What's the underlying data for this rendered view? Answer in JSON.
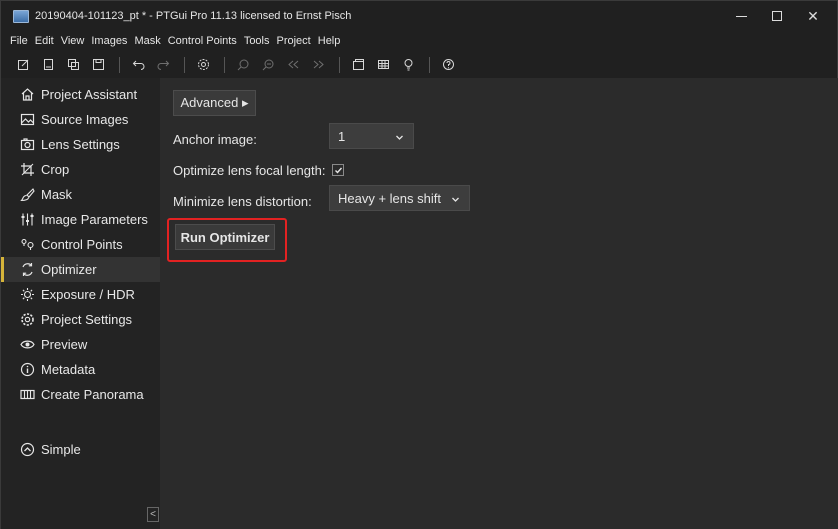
{
  "window": {
    "title": "20190404-101123_pt * - PTGui Pro 11.13 licensed to Ernst Pisch",
    "controls": {
      "minimize": "—",
      "maximize": "",
      "close": "✕"
    }
  },
  "menu": [
    "File",
    "Edit",
    "View",
    "Images",
    "Mask",
    "Control Points",
    "Tools",
    "Project",
    "Help"
  ],
  "toolbar": {
    "icons": [
      "new-project-icon",
      "open-icon",
      "save-as-icon",
      "save-icon",
      "undo-icon",
      "redo-icon",
      "settings-icon",
      "zoom-in-icon",
      "zoom-out-icon",
      "prev-icon",
      "next-icon",
      "panorama-editor-icon",
      "table-icon",
      "lightbulb-icon",
      "help-icon"
    ]
  },
  "sidebar": {
    "items": [
      {
        "label": "Project Assistant",
        "icon": "home-icon"
      },
      {
        "label": "Source Images",
        "icon": "image-icon"
      },
      {
        "label": "Lens Settings",
        "icon": "camera-icon"
      },
      {
        "label": "Crop",
        "icon": "crop-icon"
      },
      {
        "label": "Mask",
        "icon": "brush-icon"
      },
      {
        "label": "Image Parameters",
        "icon": "sliders-icon"
      },
      {
        "label": "Control Points",
        "icon": "control-points-icon"
      },
      {
        "label": "Optimizer",
        "icon": "optimizer-icon",
        "active": true
      },
      {
        "label": "Exposure / HDR",
        "icon": "sun-icon"
      },
      {
        "label": "Project Settings",
        "icon": "gear-icon"
      },
      {
        "label": "Preview",
        "icon": "eye-icon"
      },
      {
        "label": "Metadata",
        "icon": "info-icon"
      },
      {
        "label": "Create Panorama",
        "icon": "panorama-icon"
      },
      {
        "label": "Simple",
        "icon": "chevron-up-circle-icon"
      }
    ],
    "collapse_glyph": "<"
  },
  "optimizer": {
    "advanced_button": "Advanced ▸",
    "anchor_label": "Anchor image:",
    "anchor_value": "1",
    "focal_label": "Optimize lens focal length:",
    "focal_checked": true,
    "distortion_label": "Minimize lens distortion:",
    "distortion_value": "Heavy + lens shift",
    "run_button": "Run Optimizer"
  },
  "colors": {
    "accent_marker": "#d6b43a",
    "highlight_outline": "#e32222"
  }
}
